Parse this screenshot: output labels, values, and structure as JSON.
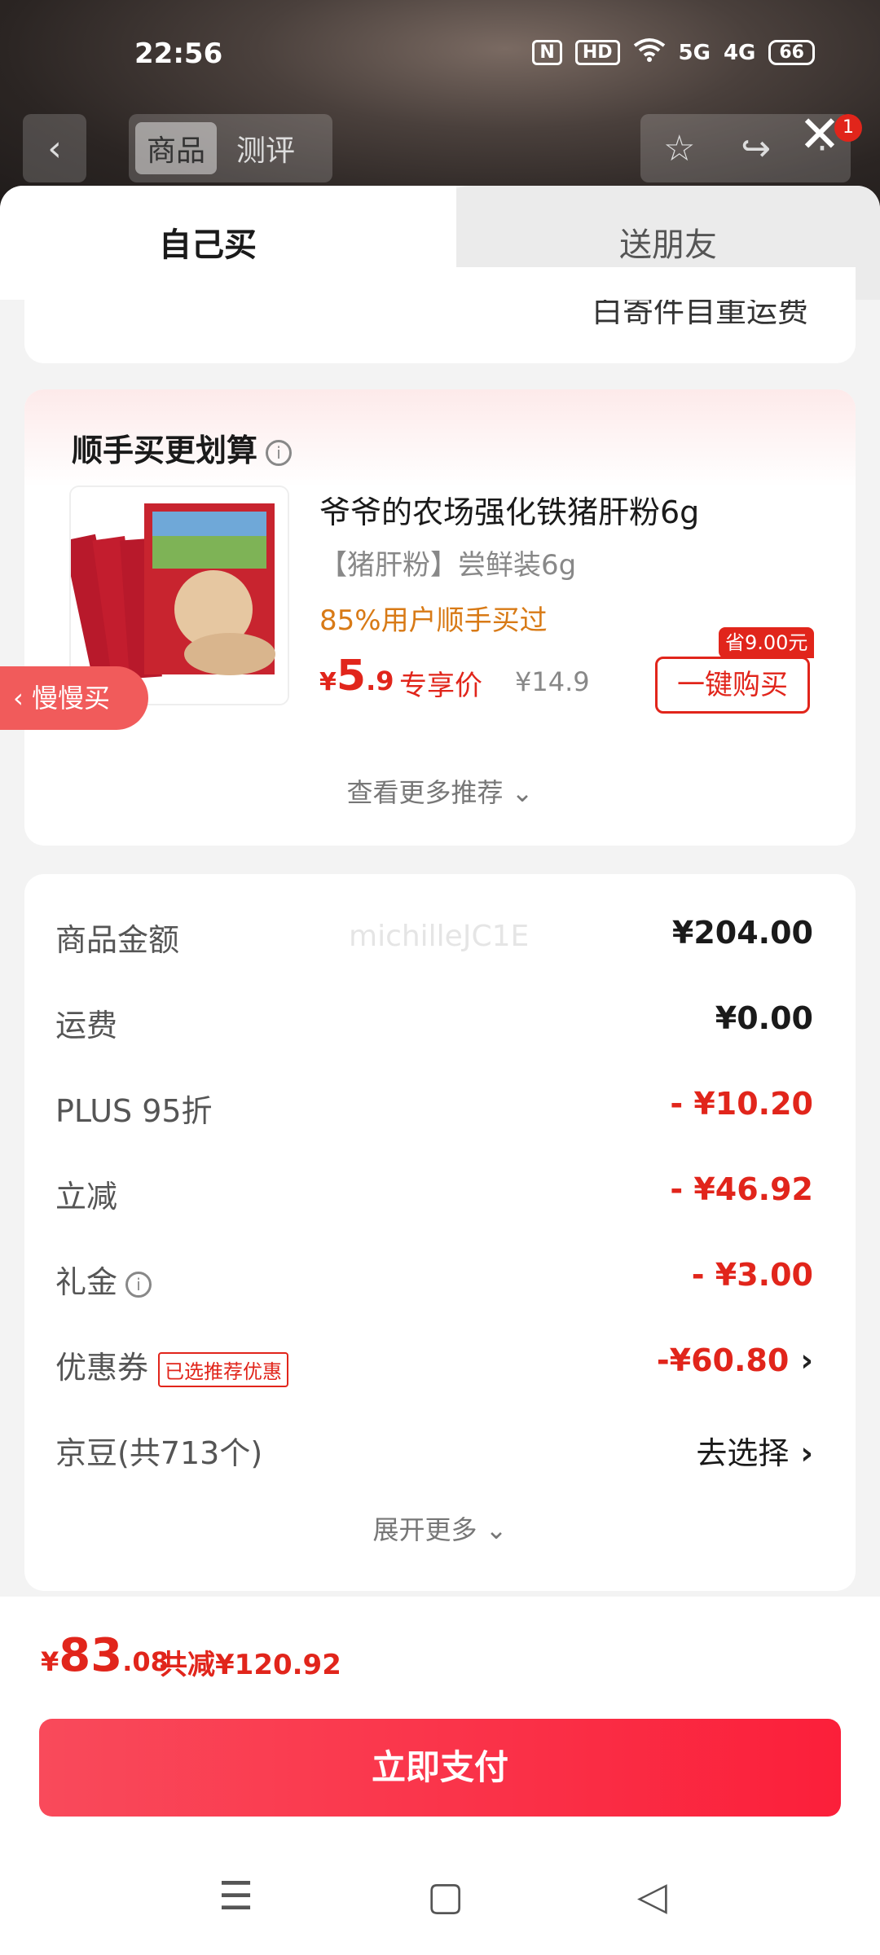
{
  "status_bar": {
    "time": "22:56",
    "icons": [
      "N",
      "HD",
      "wifi-icon",
      "5G",
      "4G"
    ],
    "battery": "66"
  },
  "top_nav": {
    "tabs": [
      "商品",
      "测评"
    ],
    "active_tab": 0,
    "badge": "1"
  },
  "sheet": {
    "tab_self": "自己买",
    "tab_gift": "送朋友",
    "top_truncated_text": "白寄件自重运费"
  },
  "bundle": {
    "title": "顺手买更划算",
    "product_name": "爷爷的农场强化铁猪肝粉6g",
    "product_spec": "【猪肝粉】尝鲜装6g",
    "social_proof": "85%用户顺手买过",
    "price_currency": "¥",
    "price_int": "5",
    "price_dec": ".9",
    "exclusive_label": "专享价",
    "original_price": "¥14.9",
    "buy_button": "一键购买",
    "save_tag": "省9.00元",
    "see_more": "查看更多推荐 ⌄",
    "slow_buy": "慢慢买"
  },
  "summary": {
    "watermark": "michilleJC1E",
    "rows": [
      {
        "label": "商品金额",
        "value": "¥204.00"
      },
      {
        "label": "运费",
        "value": "¥0.00"
      },
      {
        "label": "PLUS 95折",
        "value": "- ¥10.20"
      },
      {
        "label": "立减",
        "value": "- ¥46.92"
      },
      {
        "label": "礼金",
        "value": "- ¥3.00"
      },
      {
        "label": "优惠券",
        "tag": "已选推荐优惠",
        "value": "-¥60.80"
      },
      {
        "label": "京豆(共713个)",
        "value": "去选择"
      }
    ],
    "expand_more": "展开更多 ⌄"
  },
  "footer": {
    "total_currency": "¥",
    "total_int": "83",
    "total_dec": ".08",
    "total_saved": "共减¥120.92",
    "pay_button": "立即支付"
  },
  "colors": {
    "accent_red": "#e1251b",
    "social_orange": "#d87a16",
    "pay_gradient_start": "#f94a5b",
    "pay_gradient_end": "#fb1f3a"
  }
}
